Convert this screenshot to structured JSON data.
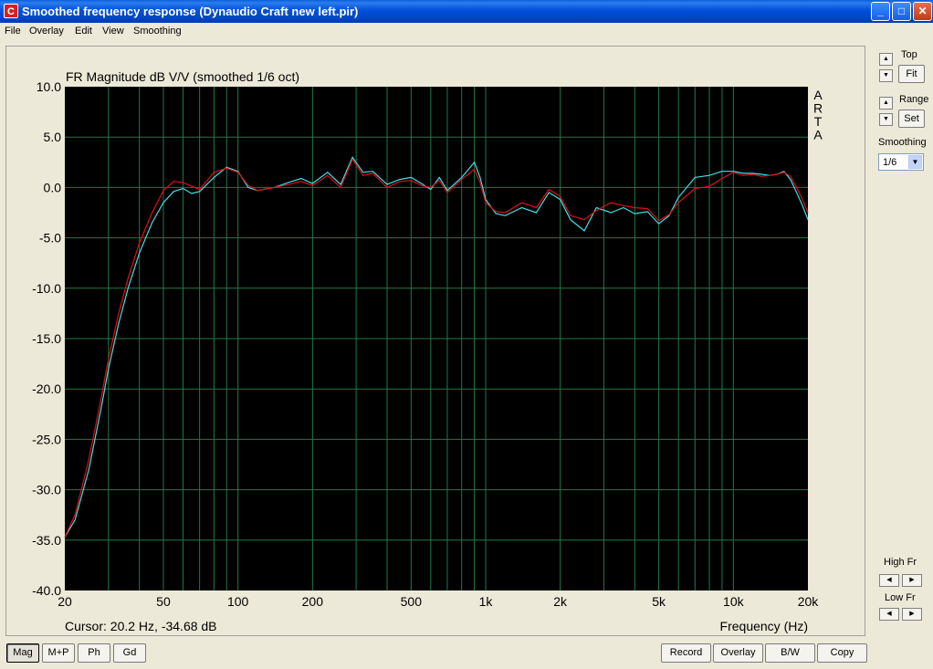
{
  "window": {
    "title": "Smoothed frequency response (Dynaudio Craft new left.pir)",
    "icon_letter": "C",
    "buttons": {
      "minimize": "_",
      "maximize": "□",
      "close": "✕"
    }
  },
  "menu": [
    "File",
    "Overlay",
    "Edit",
    "View",
    "Smoothing"
  ],
  "right_panel": {
    "top_label": "Top",
    "fit_label": "Fit",
    "range_label": "Range",
    "set_label": "Set",
    "smoothing_label": "Smoothing",
    "smoothing_value": "1/6",
    "high_fr_label": "High Fr",
    "low_fr_label": "Low Fr"
  },
  "bottom_buttons": {
    "mag": "Mag",
    "mp": "M+P",
    "ph": "Ph",
    "gd": "Gd",
    "record": "Record",
    "overlay": "Overlay",
    "bw": "B/W",
    "copy": "Copy"
  },
  "cursor_text": "Cursor: 20.2 Hz, -34.68 dB",
  "arta_letters": [
    "A",
    "R",
    "T",
    "A"
  ],
  "colors": {
    "plot_bg": "#000000",
    "grid": "#1e7a4a",
    "series_red": "#e01010",
    "series_cyan": "#40e0e8"
  },
  "chart_data": {
    "type": "line",
    "title": "FR Magnitude dB V/V (smoothed 1/6 oct)",
    "xlabel": "Frequency (Hz)",
    "ylabel": "",
    "xscale": "log",
    "xlim": [
      20,
      20000
    ],
    "ylim": [
      -40,
      10
    ],
    "x_tick_labels": [
      "20",
      "50",
      "100",
      "200",
      "500",
      "1k",
      "2k",
      "5k",
      "10k",
      "20k"
    ],
    "x_tick_values": [
      20,
      50,
      100,
      200,
      500,
      1000,
      2000,
      5000,
      10000,
      20000
    ],
    "y_tick_labels": [
      "10.0",
      "5.0",
      "0.0",
      "-5.0",
      "-10.0",
      "-15.0",
      "-20.0",
      "-25.0",
      "-30.0",
      "-35.0",
      "-40.0"
    ],
    "y_tick_values": [
      10,
      5,
      0,
      -5,
      -10,
      -15,
      -20,
      -25,
      -30,
      -35,
      -40
    ],
    "grid": true,
    "series": [
      {
        "color": "red",
        "x": [
          20,
          22,
          25,
          28,
          30,
          33,
          36,
          40,
          45,
          50,
          55,
          60,
          70,
          80,
          90,
          100,
          110,
          120,
          140,
          160,
          180,
          200,
          230,
          260,
          290,
          320,
          350,
          400,
          450,
          500,
          550,
          600,
          650,
          700,
          800,
          900,
          950,
          1000,
          1100,
          1200,
          1400,
          1600,
          1800,
          2000,
          2200,
          2500,
          2800,
          3200,
          3600,
          4000,
          4500,
          5000,
          5500,
          6000,
          7000,
          8000,
          9000,
          10000,
          11000,
          12000,
          13000,
          14000,
          15000,
          16000,
          17000,
          18000,
          19000,
          20000
        ],
        "y": [
          -34.7,
          -32.5,
          -27.0,
          -21.0,
          -17.0,
          -12.5,
          -9.0,
          -5.5,
          -2.5,
          -0.3,
          0.6,
          0.5,
          -0.2,
          1.5,
          1.9,
          1.5,
          0.2,
          -0.3,
          0.0,
          0.3,
          0.6,
          0.2,
          1.2,
          0.0,
          2.8,
          1.2,
          1.4,
          0.0,
          0.6,
          0.7,
          0.2,
          0.0,
          0.7,
          -0.5,
          0.8,
          1.8,
          0.5,
          -1.5,
          -2.4,
          -2.5,
          -1.5,
          -2.0,
          -0.2,
          -0.9,
          -2.8,
          -3.2,
          -2.3,
          -1.5,
          -1.8,
          -2.0,
          -2.1,
          -3.3,
          -2.7,
          -1.5,
          -0.1,
          0.1,
          0.9,
          1.5,
          1.2,
          1.3,
          1.1,
          1.2,
          1.3,
          1.5,
          1.1,
          0.0,
          -1.2,
          -2.5
        ]
      },
      {
        "color": "cyan",
        "x": [
          20,
          22,
          25,
          28,
          30,
          33,
          36,
          40,
          45,
          50,
          55,
          60,
          65,
          70,
          80,
          90,
          100,
          110,
          120,
          140,
          160,
          180,
          200,
          230,
          260,
          290,
          320,
          350,
          400,
          450,
          500,
          550,
          600,
          650,
          700,
          800,
          900,
          950,
          1000,
          1100,
          1200,
          1400,
          1600,
          1800,
          2000,
          2200,
          2500,
          2800,
          3200,
          3600,
          4000,
          4500,
          5000,
          5500,
          6000,
          7000,
          8000,
          9000,
          10000,
          11000,
          12000,
          13000,
          14000,
          15000,
          16000,
          17000,
          18000,
          19000,
          20000
        ],
        "y": [
          -34.7,
          -33.0,
          -28.0,
          -22.0,
          -18.0,
          -13.5,
          -10.0,
          -6.5,
          -3.5,
          -1.5,
          -0.4,
          -0.1,
          -0.6,
          -0.4,
          1.0,
          2.0,
          1.6,
          0.0,
          -0.3,
          0.0,
          0.5,
          0.9,
          0.4,
          1.5,
          0.3,
          3.0,
          1.5,
          1.6,
          0.3,
          0.8,
          1.0,
          0.4,
          -0.2,
          1.0,
          -0.3,
          1.0,
          2.5,
          1.0,
          -1.2,
          -2.6,
          -2.8,
          -2.0,
          -2.5,
          -0.5,
          -1.2,
          -3.2,
          -4.3,
          -2.0,
          -2.5,
          -2.0,
          -2.6,
          -2.4,
          -3.6,
          -2.8,
          -1.0,
          1.0,
          1.2,
          1.6,
          1.6,
          1.4,
          1.4,
          1.3,
          1.2,
          1.3,
          1.6,
          0.8,
          -0.5,
          -1.8,
          -3.2
        ]
      }
    ]
  }
}
